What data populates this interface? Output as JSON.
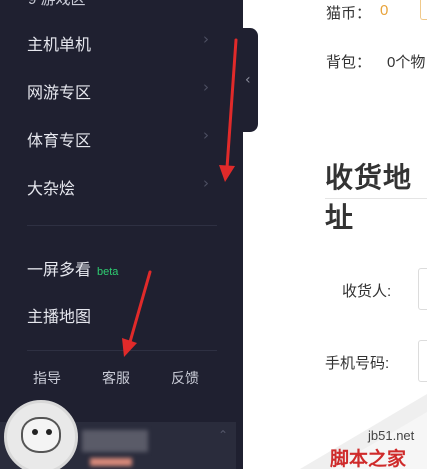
{
  "sidebar": {
    "top_partial_label": "9 游戏区",
    "nav_items": [
      {
        "label": "主机单机"
      },
      {
        "label": "网游专区"
      },
      {
        "label": "体育专区"
      },
      {
        "label": "大杂烩"
      }
    ],
    "chevron_glyph": "›",
    "multi_view": {
      "label": "一屏多看",
      "badge": "beta"
    },
    "streamer_map": {
      "label": "主播地图"
    },
    "footer_links": [
      "指导",
      "客服",
      "反馈"
    ],
    "collapse_glyph": "‹",
    "user_up_glyph": "⌃"
  },
  "main": {
    "coin": {
      "label": "猫币：",
      "value": "0"
    },
    "bag": {
      "label": "背包：",
      "value": "0个物"
    },
    "section_title": "收货地址",
    "fields": [
      {
        "label": "收货人:"
      },
      {
        "label": "手机号码:"
      }
    ]
  },
  "watermark": {
    "site": "jb51.net",
    "name": "脚本之家"
  },
  "colors": {
    "sidebar_bg": "#1f2030",
    "coin_accent": "#e8a33a",
    "beta_green": "#2ecc71",
    "annotation_red": "#e02a2a",
    "watermark_red": "#cf2b2b"
  }
}
